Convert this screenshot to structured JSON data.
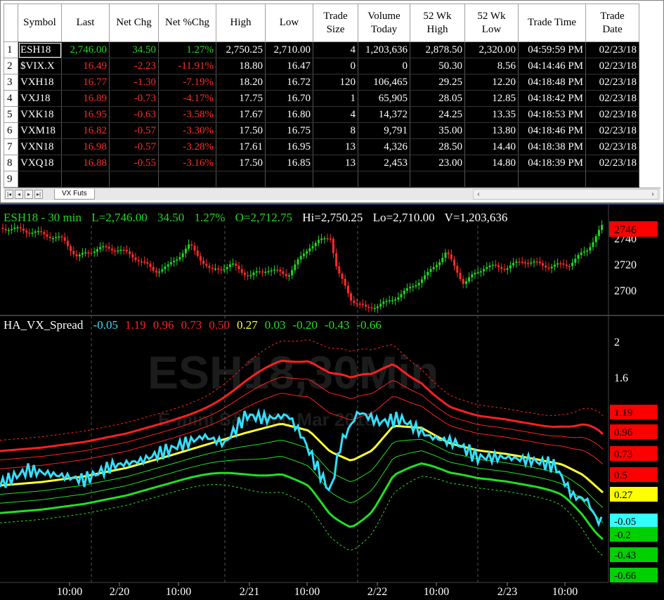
{
  "quote_table": {
    "headers": [
      "Symbol",
      "Last",
      "Net Chg",
      "Net %Chg",
      "High",
      "Low",
      "Trade\nSize",
      "Volume\nToday",
      "52 Wk\nHigh",
      "52 Wk\nLow",
      "Trade Time",
      "Trade\nDate"
    ],
    "rows": [
      {
        "n": "1",
        "symbol": "ESH18",
        "last": "2,746.00",
        "chg": "34.50",
        "pct": "1.27%",
        "high": "2,750.25",
        "low": "2,710.00",
        "size": "4",
        "vol": "1,203,636",
        "wkhigh": "2,878.50",
        "wklow": "2,320.00",
        "time": "04:59:59 PM",
        "date": "02/23/18",
        "dir": "up"
      },
      {
        "n": "2",
        "symbol": "$VIX.X",
        "last": "16.49",
        "chg": "-2.23",
        "pct": "-11.91%",
        "high": "18.80",
        "low": "16.47",
        "size": "0",
        "vol": "0",
        "wkhigh": "50.30",
        "wklow": "8.56",
        "time": "04:14:46 PM",
        "date": "02/23/18",
        "dir": "dn"
      },
      {
        "n": "3",
        "symbol": "VXH18",
        "last": "16.77",
        "chg": "-1.30",
        "pct": "-7.19%",
        "high": "18.20",
        "low": "16.72",
        "size": "120",
        "vol": "106,465",
        "wkhigh": "29.25",
        "wklow": "12.20",
        "time": "04:18:48 PM",
        "date": "02/23/18",
        "dir": "dn"
      },
      {
        "n": "4",
        "symbol": "VXJ18",
        "last": "16.89",
        "chg": "-0.73",
        "pct": "-4.17%",
        "high": "17.75",
        "low": "16.70",
        "size": "1",
        "vol": "65,905",
        "wkhigh": "28.05",
        "wklow": "12.85",
        "time": "04:18:42 PM",
        "date": "02/23/18",
        "dir": "dn"
      },
      {
        "n": "5",
        "symbol": "VXK18",
        "last": "16.95",
        "chg": "-0.63",
        "pct": "-3.58%",
        "high": "17.67",
        "low": "16.80",
        "size": "4",
        "vol": "14,372",
        "wkhigh": "24.25",
        "wklow": "13.35",
        "time": "04:18:53 PM",
        "date": "02/23/18",
        "dir": "dn"
      },
      {
        "n": "6",
        "symbol": "VXM18",
        "last": "16.82",
        "chg": "-0.57",
        "pct": "-3.30%",
        "high": "17.50",
        "low": "16.75",
        "size": "8",
        "vol": "9,791",
        "wkhigh": "35.00",
        "wklow": "13.80",
        "time": "04:18:46 PM",
        "date": "02/23/18",
        "dir": "dn"
      },
      {
        "n": "7",
        "symbol": "VXN18",
        "last": "16.98",
        "chg": "-0.57",
        "pct": "-3.28%",
        "high": "17.61",
        "low": "16.95",
        "size": "13",
        "vol": "4,326",
        "wkhigh": "28.50",
        "wklow": "14.40",
        "time": "04:18:38 PM",
        "date": "02/23/18",
        "dir": "dn"
      },
      {
        "n": "8",
        "symbol": "VXQ18",
        "last": "16.88",
        "chg": "-0.55",
        "pct": "-3.16%",
        "high": "17.50",
        "low": "16.85",
        "size": "13",
        "vol": "2,453",
        "wkhigh": "23.00",
        "wklow": "14.80",
        "time": "04:18:39 PM",
        "date": "02/23/18",
        "dir": "dn"
      },
      {
        "n": "9",
        "symbol": "",
        "last": "",
        "chg": "",
        "pct": "",
        "high": "",
        "low": "",
        "size": "",
        "vol": "",
        "wkhigh": "",
        "wklow": "",
        "time": "",
        "date": "",
        "dir": ""
      }
    ],
    "sheet_tab": "VX Futs"
  },
  "price_chart": {
    "symbol_interval": "ESH18 - 30 min",
    "last": "L=2,746.00",
    "chg": "34.50",
    "pct": "1.27%",
    "open": "O=2,712.75",
    "hi": "Hi=2,750.25",
    "lo": "Lo=2,710.00",
    "vol": "V=1,203,636",
    "axis_ticks": [
      "2740",
      "2720",
      "2700"
    ],
    "last_tag": "2746"
  },
  "indicator": {
    "name": "HA_VX_Spread",
    "values": [
      "-0.05",
      "1.19",
      "0.96",
      "0.73",
      "0.50",
      "0.27",
      "0.03",
      "-0.20",
      "-0.43",
      "-0.66"
    ],
    "value_colors": [
      "#33e0ff",
      "#ff2020",
      "#ff2020",
      "#ff2020",
      "#ff2020",
      "#ffff30",
      "#20e020",
      "#20e020",
      "#20e020",
      "#20e020"
    ],
    "axis_ticks": [
      "2",
      "1.6"
    ],
    "tags": [
      {
        "label": "1.19",
        "bg": "#ff0000",
        "fg": "#000000"
      },
      {
        "label": "0.96",
        "bg": "#ff0000",
        "fg": "#000000"
      },
      {
        "label": "0.73",
        "bg": "#ff0000",
        "fg": "#000000"
      },
      {
        "label": "0.5",
        "bg": "#ff0000",
        "fg": "#000000"
      },
      {
        "label": "0.27",
        "bg": "#ffff00",
        "fg": "#000000"
      },
      {
        "label": "-0.05",
        "bg": "#33ffff",
        "fg": "#000000"
      },
      {
        "label": "-0.2",
        "bg": "#00d000",
        "fg": "#000000"
      },
      {
        "label": "-0.43",
        "bg": "#00d000",
        "fg": "#000000"
      },
      {
        "label": "-0.66",
        "bg": "#00d000",
        "fg": "#000000"
      }
    ],
    "watermark_line1": "ESH18,30Min",
    "watermark_line2": "E-mini S&P 500 Mar 2018"
  },
  "time_axis": [
    "10:00",
    "2/20",
    "10:00",
    "2/21",
    "10:00",
    "2/22",
    "10:00",
    "2/23",
    "10:00"
  ],
  "colors": {
    "up": "#21d821",
    "down": "#ff2a2a",
    "spread_line": "#33e0ff",
    "mid_band": "#ffff30"
  }
}
